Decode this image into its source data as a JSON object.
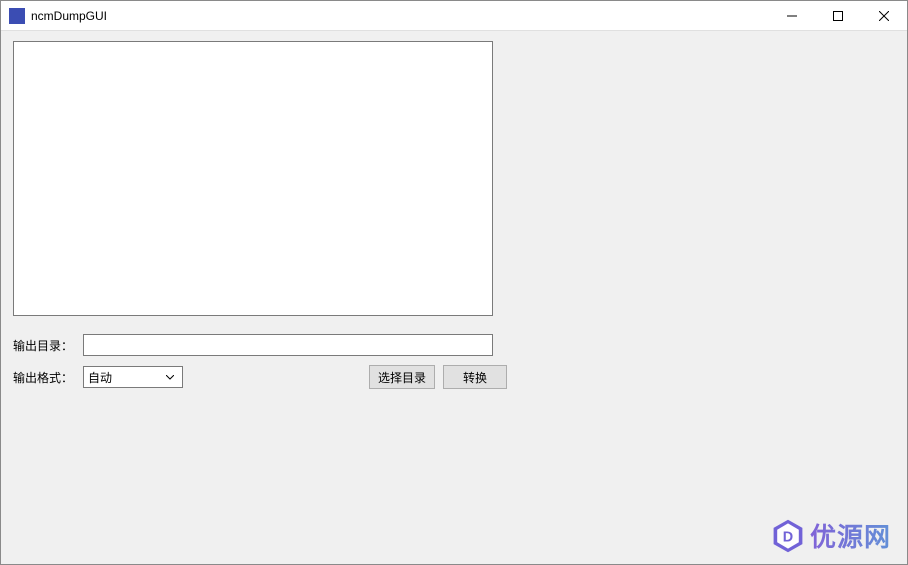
{
  "window": {
    "title": "ncmDumpGUI"
  },
  "form": {
    "output_dir_label": "输出目录：",
    "output_dir_value": "",
    "output_format_label": "输出格式：",
    "output_format_value": "自动",
    "select_dir_button": "选择目录",
    "convert_button": "转换"
  },
  "watermark": {
    "text": "优源网"
  }
}
